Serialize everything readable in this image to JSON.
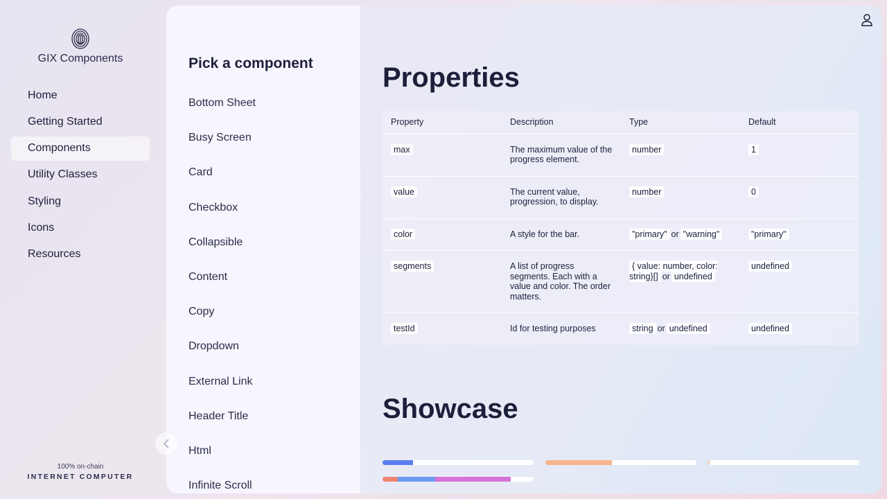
{
  "nav": {
    "app_title": "GIX Components",
    "items": [
      {
        "label": "Home",
        "active": false
      },
      {
        "label": "Getting Started",
        "active": false
      },
      {
        "label": "Components",
        "active": true
      },
      {
        "label": "Utility Classes",
        "active": false
      },
      {
        "label": "Styling",
        "active": false
      },
      {
        "label": "Icons",
        "active": false
      },
      {
        "label": "Resources",
        "active": false
      }
    ],
    "footer_small": "100% on-chain",
    "footer_brand": "INTERNET COMPUTER",
    "icons": {
      "logo": "fingerprint-logo",
      "collapse": "chevron-left-icon",
      "user": "user-icon"
    }
  },
  "picker": {
    "title": "Pick a component",
    "items": [
      "Bottom Sheet",
      "Busy Screen",
      "Card",
      "Checkbox",
      "Collapsible",
      "Content",
      "Copy",
      "Dropdown",
      "External Link",
      "Header Title",
      "Html",
      "Infinite Scroll"
    ]
  },
  "properties": {
    "heading": "Properties",
    "columns": [
      "Property",
      "Description",
      "Type",
      "Default"
    ],
    "rows": [
      {
        "property": "max",
        "description": "The maximum value of the progress element.",
        "type": [
          "number"
        ],
        "default": "1"
      },
      {
        "property": "value",
        "description": "The current value, progression, to display.",
        "type": [
          "number"
        ],
        "default": "0"
      },
      {
        "property": "color",
        "description": "A style for the bar.",
        "type": [
          "\"primary\"",
          "\"warning\""
        ],
        "default": "\"primary\""
      },
      {
        "property": "segments",
        "description": "A list of progress segments. Each with a value and color. The order matters.",
        "type": [
          "{ value: number, color: string}[]",
          "undefined"
        ],
        "default": "undefined"
      },
      {
        "property": "testId",
        "description": "Id for testing purposes",
        "type": [
          "string",
          "undefined"
        ],
        "default": "undefined"
      }
    ],
    "type_separator": "or"
  },
  "showcase": {
    "heading": "Showcase",
    "bars": [
      {
        "segments": [
          {
            "value": 0.2,
            "color": "#5b7ef0"
          }
        ]
      },
      {
        "segments": [
          {
            "value": 0.44,
            "color": "#f7b58d"
          }
        ]
      },
      {
        "segments": [
          {
            "value": 0.005,
            "color": "#f7b58d"
          }
        ]
      },
      {
        "segments": [
          {
            "value": 0.1,
            "color": "#f0846e"
          },
          {
            "value": 0.25,
            "color": "#6a9bf0"
          },
          {
            "value": 0.5,
            "color": "#d774d6"
          }
        ]
      }
    ]
  }
}
